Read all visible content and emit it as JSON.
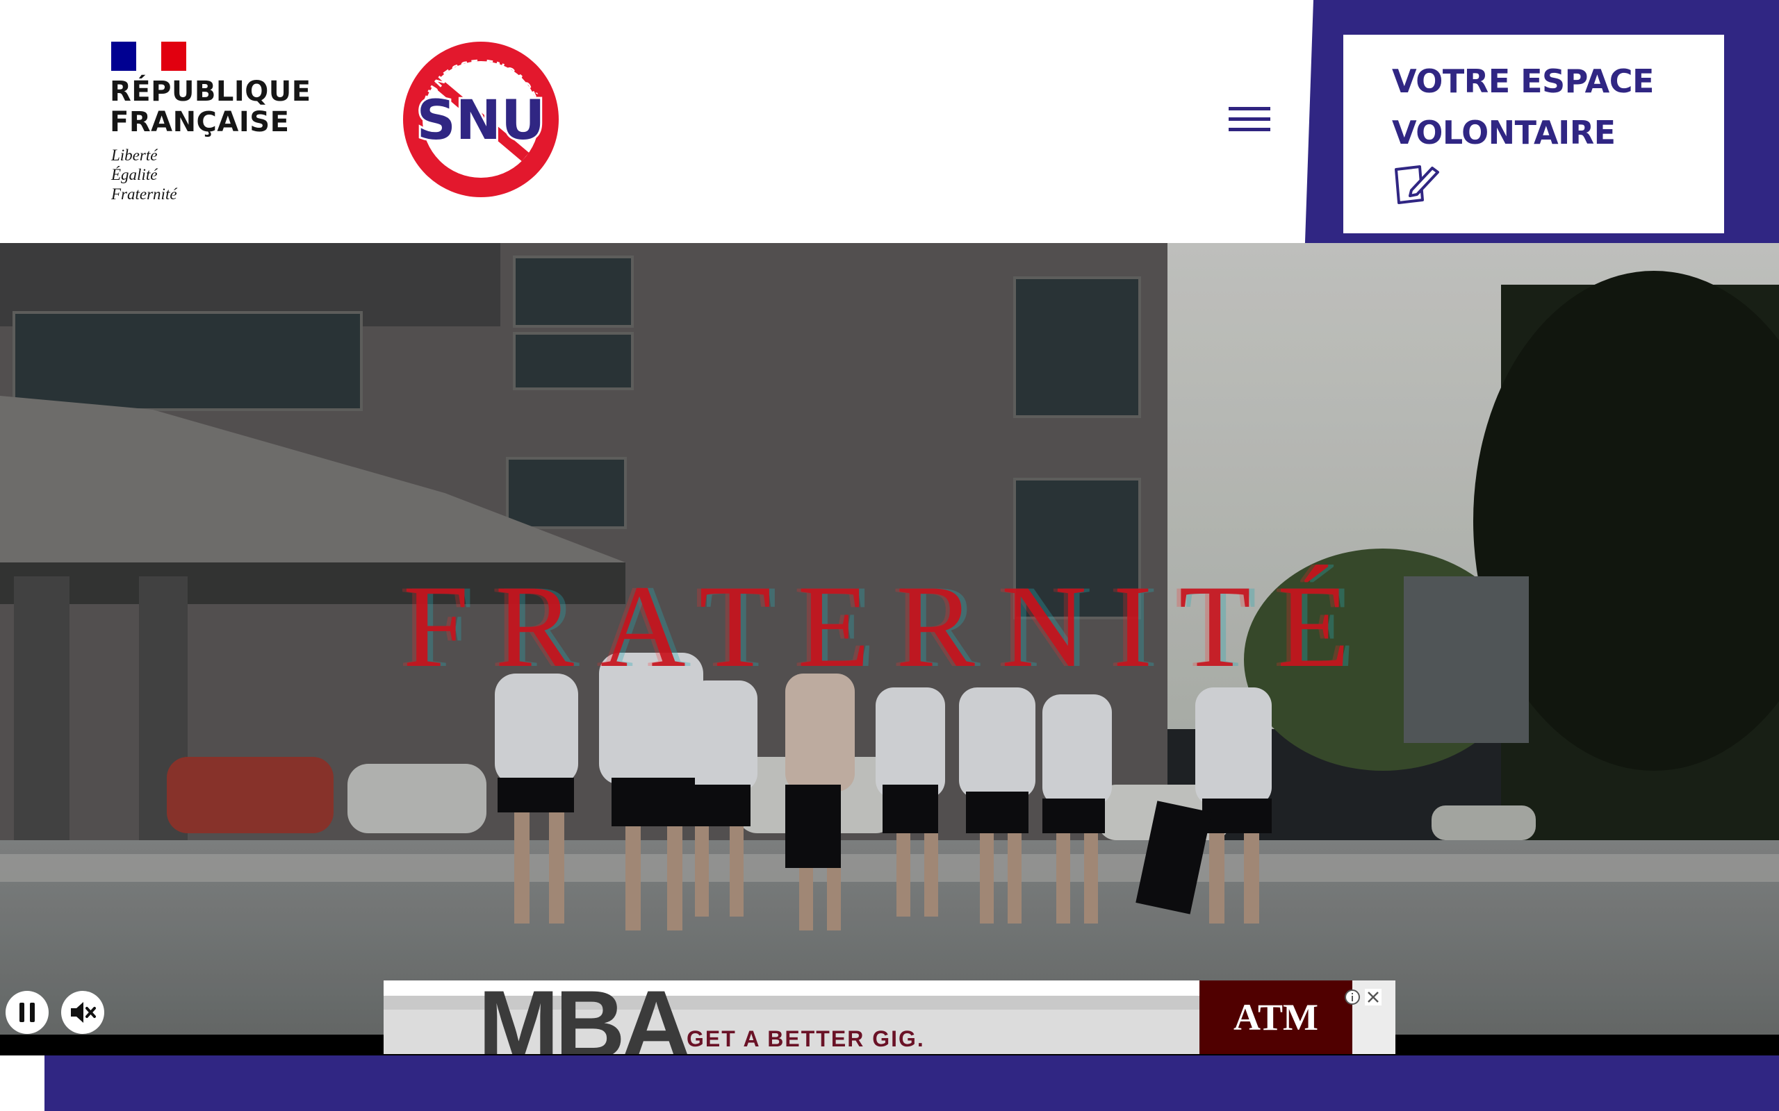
{
  "header": {
    "republique": {
      "name": "RÉPUBLIQUE\nFRANÇAISE",
      "motto": "Liberté\nÉgalité\nFraternité",
      "flag_colors": [
        "#000091",
        "#ffffff",
        "#e1000f"
      ]
    },
    "snu_logo": {
      "ring_text": "JEUNESSE ENGAGÉE",
      "wordmark": "SNU"
    },
    "menu_icon": "hamburger-icon",
    "espace": {
      "title": "VOTRE ESPACE\nVOLONTAIRE",
      "icon": "edit-note-icon"
    }
  },
  "video": {
    "overlay_word": "FRATERNITÉ",
    "controls": {
      "pause_icon": "pause-icon",
      "mute_icon": "mute-icon"
    }
  },
  "ad": {
    "headline": "MBA",
    "tagline": "GET A BETTER GIG.",
    "brand": "ATM",
    "info_icon": "info-icon",
    "close_icon": "close-icon"
  },
  "colors": {
    "brand_blue": "#302683",
    "snu_red": "#e3182d",
    "overlay_red": "#c8141e",
    "ad_maroon": "#500000"
  }
}
